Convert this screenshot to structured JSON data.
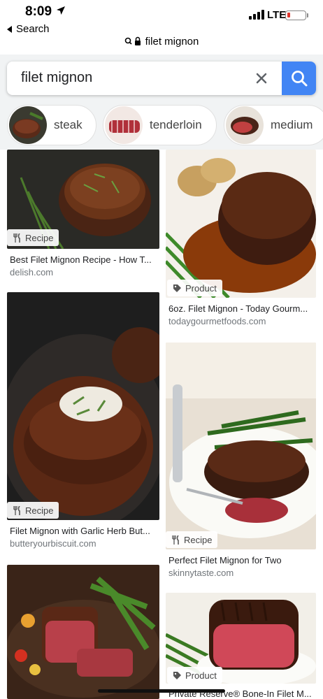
{
  "status_bar": {
    "time": "8:09",
    "network": "LTE",
    "battery_level": 0.15
  },
  "back_label": "Search",
  "url": "filet mignon",
  "search": {
    "query": "filet mignon"
  },
  "chips": [
    {
      "label": "steak"
    },
    {
      "label": "tenderloin"
    },
    {
      "label": "medium"
    }
  ],
  "results": [
    {
      "badge": "Recipe",
      "title": "Best Filet Mignon Recipe - How T...",
      "source": "delish.com"
    },
    {
      "badge": "Product",
      "title": "6oz. Filet Mignon - Today Gourm...",
      "source": "todaygourmetfoods.com"
    },
    {
      "badge": "Recipe",
      "title": "Filet Mignon with Garlic Herb But...",
      "source": "butteryourbiscuit.com"
    },
    {
      "badge": "Recipe",
      "title": "Perfect Filet Mignon for Two",
      "source": "skinnytaste.com"
    },
    {
      "badge": "",
      "title": "",
      "source": ""
    },
    {
      "badge": "Product",
      "title": "Private Reserve® Bone-In Filet M...",
      "source": ""
    }
  ],
  "colors": {
    "accent": "#4285f4",
    "chip_bg": "#f1f3f4",
    "battery_low": "#e0342c"
  }
}
